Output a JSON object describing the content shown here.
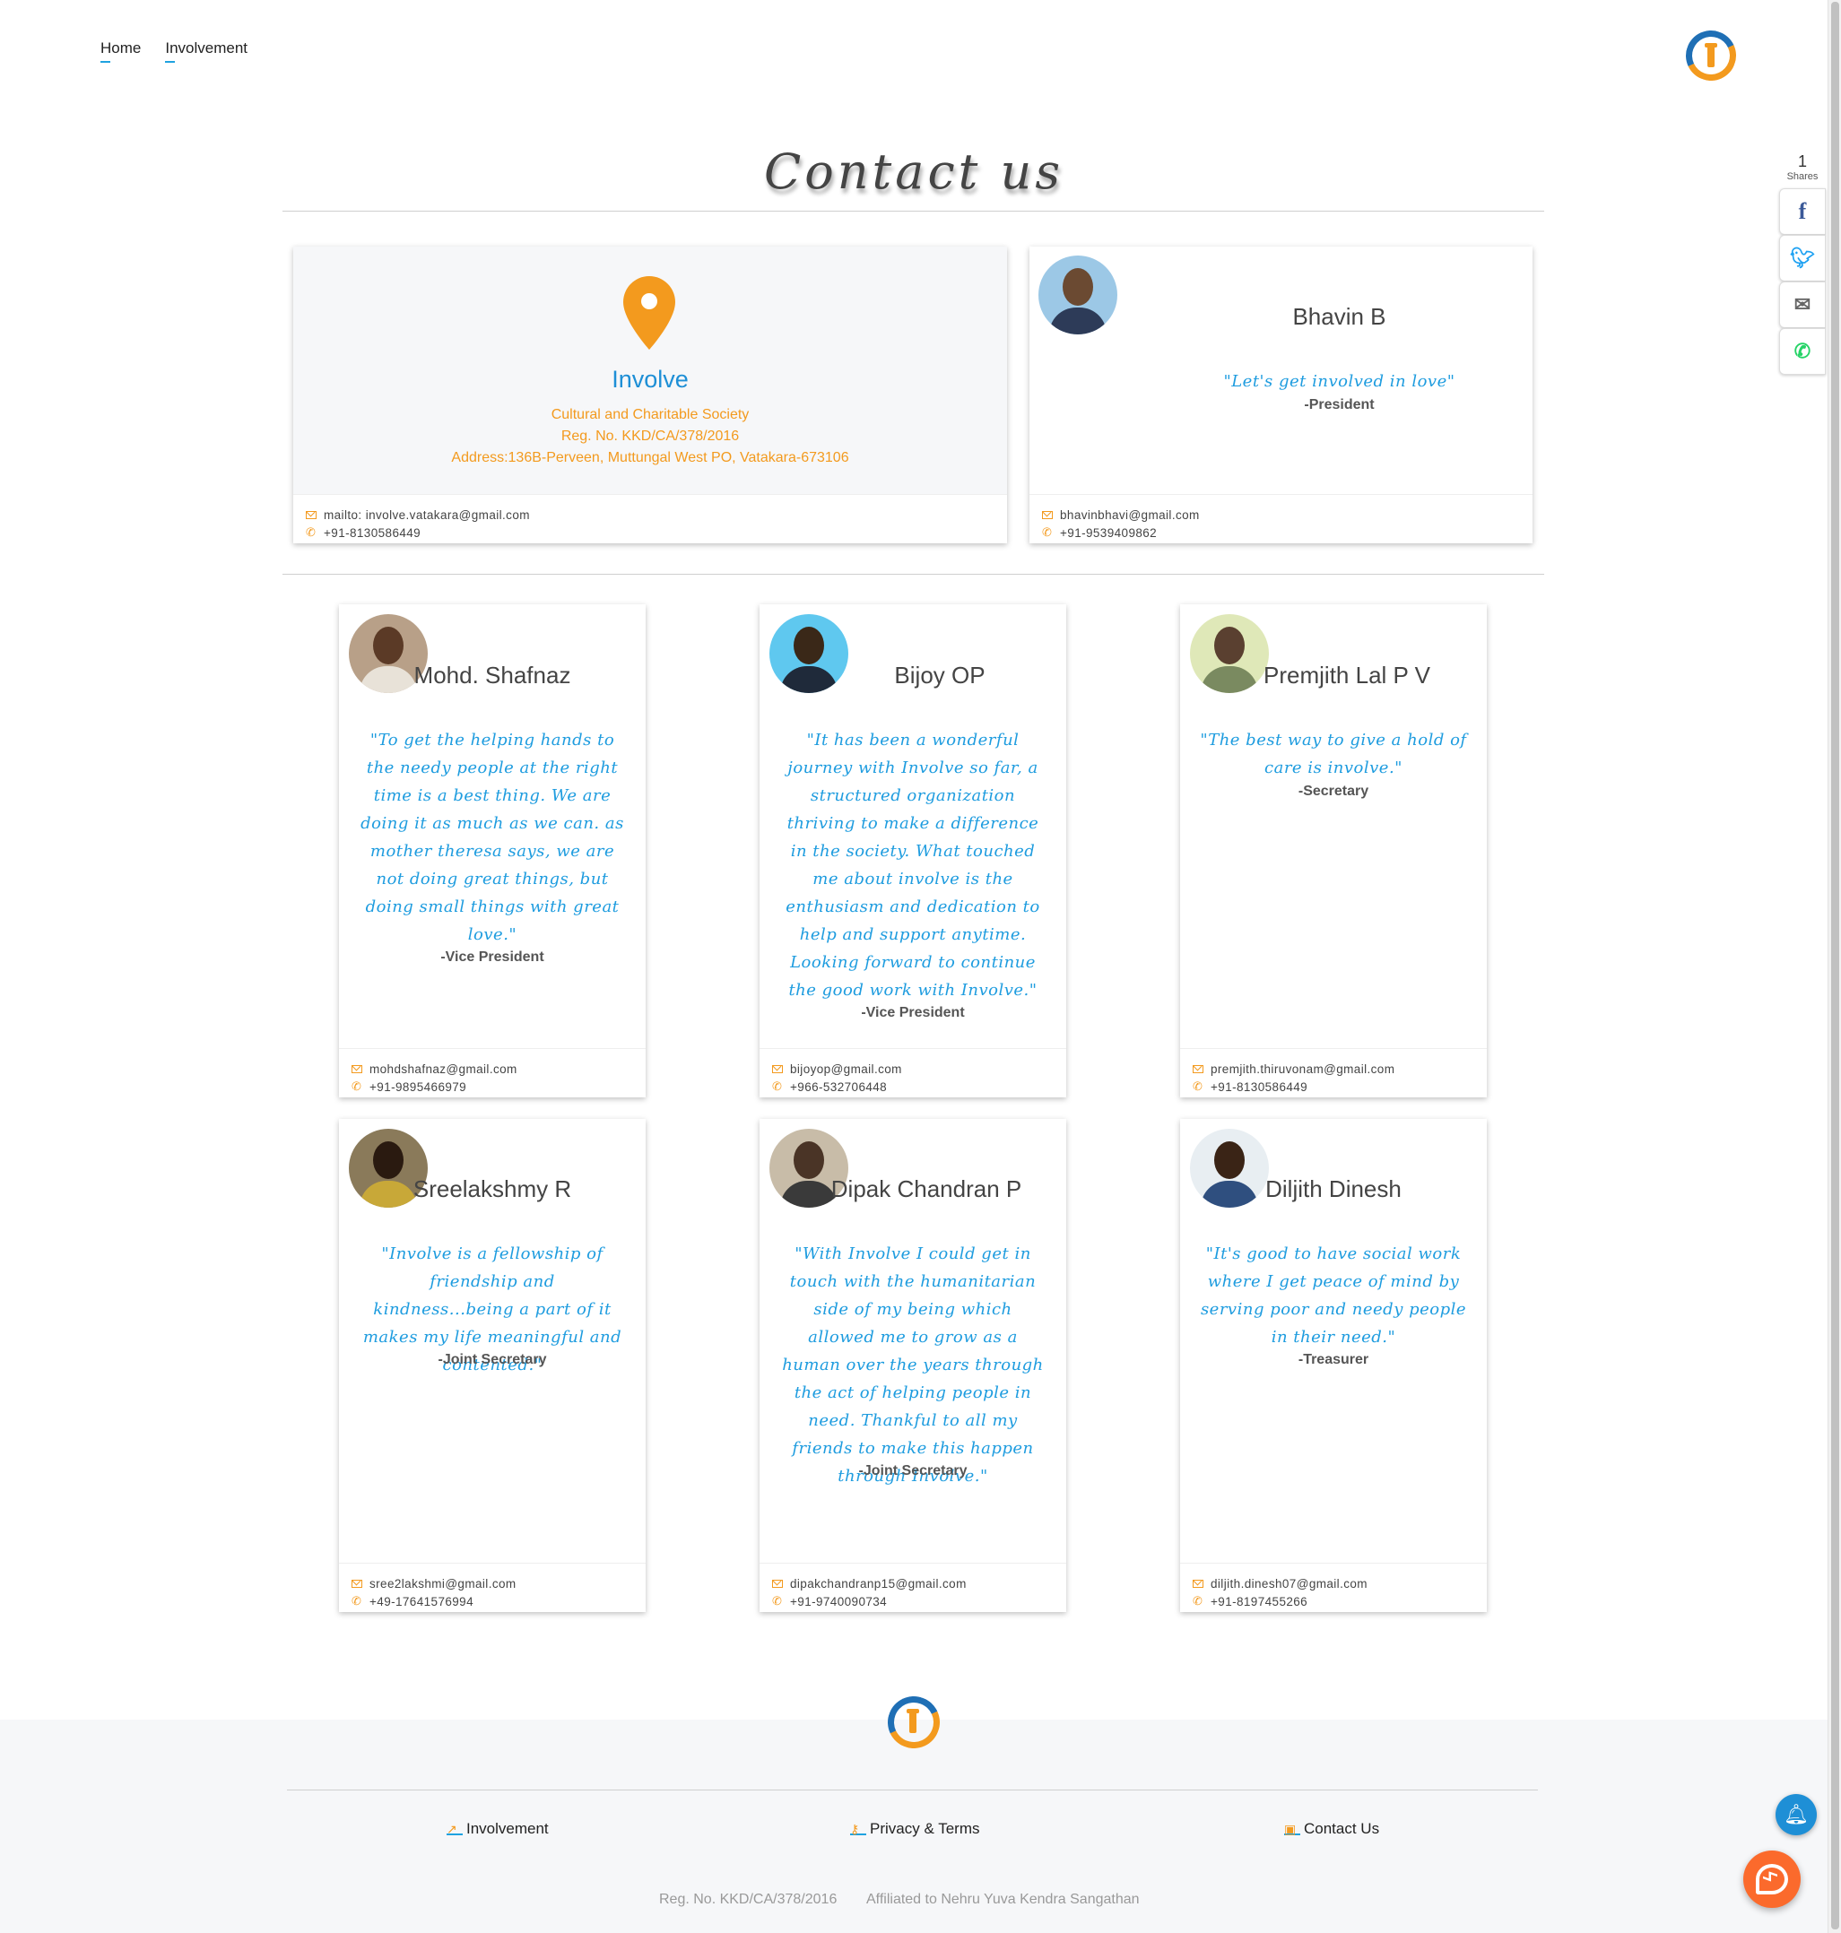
{
  "nav": {
    "home": "Home",
    "involvement": "Involvement"
  },
  "page": {
    "title": "Contact us"
  },
  "org": {
    "name": "Involve",
    "lines": [
      "Cultural and Charitable Society",
      "Reg. No. KKD/CA/378/2016",
      "Address:136B-Perveen, Muttungal West PO, Vatakara-673106"
    ],
    "email": "mailto: involve.vatakara@gmail.com",
    "phone": "+91-8130586449"
  },
  "president": {
    "name": "Bhavin B",
    "quote": "\"Let's get involved in love\"",
    "role": "-President",
    "email": "bhavinbhavi@gmail.com",
    "phone": "+91-9539409862"
  },
  "members": [
    {
      "name": "Mohd. Shafnaz",
      "quote": "\"To get the helping hands to the needy people at the right time is a best thing. We are doing it as much as we can. as mother theresa says, we are not doing great things, but doing small things with great love.\"",
      "role": "-Vice President",
      "email": "mohdshafnaz@gmail.com",
      "phone": "+91-9895466979"
    },
    {
      "name": "Bijoy OP",
      "quote": "\"It has been a wonderful journey with Involve so far, a structured organization thriving to make a difference in the society. What touched me about involve is the enthusiasm and dedication to help and support anytime. Looking forward to continue the good work with Involve.\"",
      "role": "-Vice President",
      "email": "bijoyop@gmail.com",
      "phone": "+966-532706448"
    },
    {
      "name": "Premjith Lal P V",
      "quote": "\"The best way to give a hold of care is involve.\"",
      "role": "-Secretary",
      "email": "premjith.thiruvonam@gmail.com",
      "phone": "+91-8130586449"
    },
    {
      "name": "Sreelakshmy R",
      "quote": "\"Involve is a fellowship of friendship and kindness...being a part of it makes my life meaningful and contented.\"",
      "role": "-Joint Secretary",
      "email": "sree2lakshmi@gmail.com",
      "phone": "+49-17641576994"
    },
    {
      "name": "Dipak Chandran P",
      "quote": "\"With Involve I could get in touch with the humanitarian side of my being which allowed me to grow as a human over the years through the act of helping people in need. Thankful to all my friends to make this happen through Involve.\"",
      "role": "-Joint Secretary",
      "email": "dipakchandranp15@gmail.com",
      "phone": "+91-9740090734"
    },
    {
      "name": "Diljith Dinesh",
      "quote": "\"It's good to have social work where I get peace of mind by serving poor and needy people in their need.\"",
      "role": "-Treasurer",
      "email": "diljith.dinesh07@gmail.com",
      "phone": "+91-8197455266"
    }
  ],
  "share": {
    "count": "1",
    "label": "Shares"
  },
  "footer": {
    "links": [
      "Involvement",
      "Privacy & Terms",
      "Contact Us"
    ],
    "reg": "Reg. No. KKD/CA/378/2016",
    "affiliation": "Affiliated to Nehru Yuva Kendra Sangathan"
  },
  "colors": {
    "accent": "#f39a1e",
    "blue": "#1e9cdf"
  }
}
